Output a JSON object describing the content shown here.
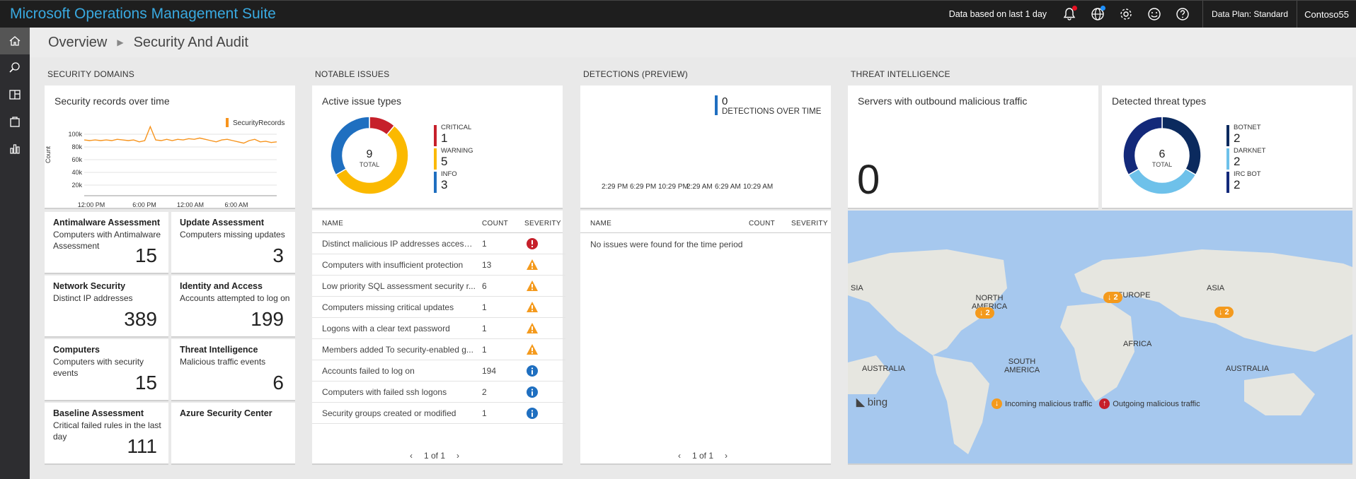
{
  "app": {
    "title": "Microsoft Operations Management Suite"
  },
  "topbar": {
    "data_range": "Data based on last 1 day",
    "data_plan": "Data Plan: Standard",
    "workspace": "Contoso55"
  },
  "breadcrumb": {
    "overview": "Overview",
    "current": "Security And Audit"
  },
  "sections": {
    "security_domains": "SECURITY DOMAINS",
    "notable_issues": "NOTABLE ISSUES",
    "detections": "DETECTIONS (PREVIEW)",
    "threat_intel": "THREAT INTELLIGENCE"
  },
  "records_chart": {
    "title": "Security records over time",
    "chart_data": {
      "type": "line",
      "series": [
        {
          "name": "SecurityRecords",
          "color": "#f7941d",
          "values": [
            91,
            90,
            91,
            90,
            91,
            90,
            92,
            91,
            90,
            91,
            88,
            90,
            112,
            91,
            90,
            92,
            90,
            92,
            91,
            93,
            92,
            94,
            92,
            90,
            88,
            91,
            92,
            90,
            88,
            86,
            90,
            92,
            88,
            89,
            87,
            88
          ]
        }
      ],
      "x_ticks": [
        "12:00 PM",
        "6:00 PM",
        "12:00 AM",
        "6:00 AM"
      ],
      "y_ticks": [
        "100k",
        "80k",
        "60k",
        "40k",
        "20k"
      ],
      "ylabel": "Count",
      "ylim": [
        10,
        110
      ]
    }
  },
  "tiles": [
    {
      "title": "Antimalware Assessment",
      "sub": "Computers with Antimalware Assessment",
      "value": "15"
    },
    {
      "title": "Update Assessment",
      "sub": "Computers missing updates",
      "value": "3"
    },
    {
      "title": "Network Security",
      "sub": "Distinct IP addresses",
      "value": "389"
    },
    {
      "title": "Identity and Access",
      "sub": "Accounts attempted to log on",
      "value": "199"
    },
    {
      "title": "Computers",
      "sub": "Computers with security events",
      "value": "15"
    },
    {
      "title": "Threat Intelligence",
      "sub": "Malicious traffic events",
      "value": "6"
    },
    {
      "title": "Baseline Assessment",
      "sub": "Critical failed rules in the last day",
      "value": "111"
    },
    {
      "title": "Azure Security Center",
      "sub": "",
      "value": ""
    }
  ],
  "issues_donut": {
    "title": "Active issue types",
    "total": "9",
    "total_label": "TOTAL",
    "chart_data": {
      "type": "pie",
      "slices": [
        {
          "label": "CRITICAL",
          "value": 1,
          "color": "#c6202b"
        },
        {
          "label": "WARNING",
          "value": 5,
          "color": "#fbb900"
        },
        {
          "label": "INFO",
          "value": 3,
          "color": "#1f6fc0"
        }
      ]
    }
  },
  "issues_table": {
    "headers": {
      "name": "NAME",
      "count": "COUNT",
      "severity": "SEVERITY"
    },
    "rows": [
      {
        "name": "Distinct malicious IP addresses accessed",
        "count": "1",
        "severity": "critical"
      },
      {
        "name": "Computers with insufficient protection",
        "count": "13",
        "severity": "warning"
      },
      {
        "name": "Low priority SQL assessment security r...",
        "count": "6",
        "severity": "warning"
      },
      {
        "name": "Computers missing critical updates",
        "count": "1",
        "severity": "warning"
      },
      {
        "name": "Logons with a clear text password",
        "count": "1",
        "severity": "warning"
      },
      {
        "name": "Members added To security-enabled g...",
        "count": "1",
        "severity": "warning"
      },
      {
        "name": "Accounts failed to log on",
        "count": "194",
        "severity": "info"
      },
      {
        "name": "Computers with failed ssh logons",
        "count": "2",
        "severity": "info"
      },
      {
        "name": "Security groups created or modified",
        "count": "1",
        "severity": "info"
      }
    ],
    "pager": "1 of 1"
  },
  "detections": {
    "value": "0",
    "label": "DETECTIONS OVER TIME",
    "x_ticks": [
      "2:29 PM",
      "6:29 PM",
      "10:29 PM",
      "2:29 AM",
      "6:29 AM",
      "10:29 AM"
    ],
    "headers": {
      "name": "NAME",
      "count": "COUNT",
      "severity": "SEVERITY"
    },
    "empty": "No issues were found for the time period",
    "pager": "1 of 1"
  },
  "servers_card": {
    "title": "Servers with outbound malicious traffic",
    "value": "0"
  },
  "threat_donut": {
    "title": "Detected threat types",
    "total": "6",
    "total_label": "TOTAL",
    "chart_data": {
      "type": "pie",
      "slices": [
        {
          "label": "BOTNET",
          "value": 2,
          "color": "#0b2a5e"
        },
        {
          "label": "DARKNET",
          "value": 2,
          "color": "#6ec1ea"
        },
        {
          "label": "IRC BOT",
          "value": 2,
          "color": "#13297a"
        }
      ]
    }
  },
  "map": {
    "labels": {
      "asia_left": "SIA",
      "north_america": "NORTH AMERICA",
      "europe": "EUROPE",
      "asia": "ASIA",
      "africa": "AFRICA",
      "south_america": "SOUTH AMERICA",
      "australia_left": "AUSTRALIA",
      "australia_right": "AUSTRALIA"
    },
    "pins": [
      "2",
      "2",
      "2"
    ],
    "bing": "bing",
    "legend_incoming": "Incoming malicious traffic",
    "legend_outgoing": "Outgoing malicious traffic"
  }
}
